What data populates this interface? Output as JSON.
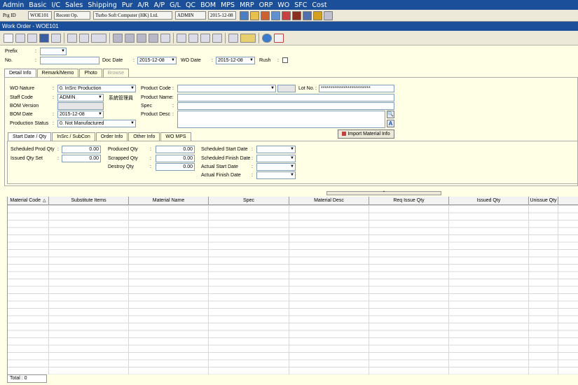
{
  "menu": [
    "Admin",
    "Basic",
    "I/C",
    "Sales",
    "Shipping",
    "Pur",
    "A/R",
    "A/P",
    "G/L",
    "QC",
    "BOM",
    "MPS",
    "MRP",
    "ORP",
    "WO",
    "SFC",
    "Cost"
  ],
  "info": {
    "prg_label": "Prg ID",
    "prg_id": "WOE101",
    "recent": "Recent Op.",
    "company": "Turbo Soft Computer (HK) Ltd.",
    "user": "ADMIN",
    "date": "2015-12-08"
  },
  "window_title": "Work Order - WOE101",
  "header": {
    "prefix_label": "Prefix",
    "prefix_value": "",
    "no_label": "No.",
    "no_value": "",
    "doc_date_label": "Doc Date",
    "doc_date": "2015-12-08",
    "wo_date_label": "WO Date",
    "wo_date": "2015-12-08",
    "rush_label": "Rush",
    "colon": ":"
  },
  "main_tabs": [
    "Detail Info",
    "Remark/Memo",
    "Photo",
    "Browse"
  ],
  "detail": {
    "wo_nature_label": "WO Nature",
    "wo_nature": "0. InSrc Production",
    "staff_code_label": "Staff Code",
    "staff_code": "ADMIN",
    "staff_name": "系統管理員",
    "bom_version_label": "BOM Version",
    "bom_version": "",
    "bom_date_label": "BOM Date",
    "bom_date": "2015-12-08",
    "production_status_label": "Production Status",
    "production_status": "0. Not Manufactured",
    "product_code_label": "Product Code",
    "lot_no_label": "Lot No.",
    "lot_no": "**************************",
    "product_name_label": "Product Name:",
    "spec_label": "Spec",
    "product_desc_label": "Product Desc"
  },
  "sub_tabs": [
    "Start Date / Qty",
    "InSrc / SubCon",
    "Order Info",
    "Other Info",
    "WO MPS"
  ],
  "import_button": "Import Material Info",
  "qty": {
    "scheduled_prod_qty_label": "Scheduled Prod Qty",
    "scheduled_prod_qty": "0.00",
    "issued_qty_set_label": "Issued Qty Set",
    "issued_qty_set": "0.00",
    "produced_qty_label": "Produced Qty",
    "produced_qty": "0.00",
    "scrapped_qty_label": "Scrapped Qty",
    "scrapped_qty": "0.00",
    "destroy_qty_label": "Destroy Qty",
    "destroy_qty": "0.00",
    "scheduled_start_date_label": "Scheduled Start Date",
    "scheduled_finish_date_label": "Scheduled Finish Date",
    "actual_start_date_label": "Actual Start Date",
    "actual_finish_date_label": "Actual Finish Date"
  },
  "grid": {
    "columns": [
      "Material Code",
      "Substitute Items",
      "Material Name",
      "Spec",
      "Material Desc",
      "Req Issue Qty",
      "Issued Qty",
      "Unissue Qty"
    ],
    "sort_indicator": "△"
  },
  "footer": {
    "total": "Total : 0"
  },
  "glyphs": {
    "dropdown": "▼",
    "search": "🔍",
    "font": "A",
    "collapse": "⌃"
  }
}
